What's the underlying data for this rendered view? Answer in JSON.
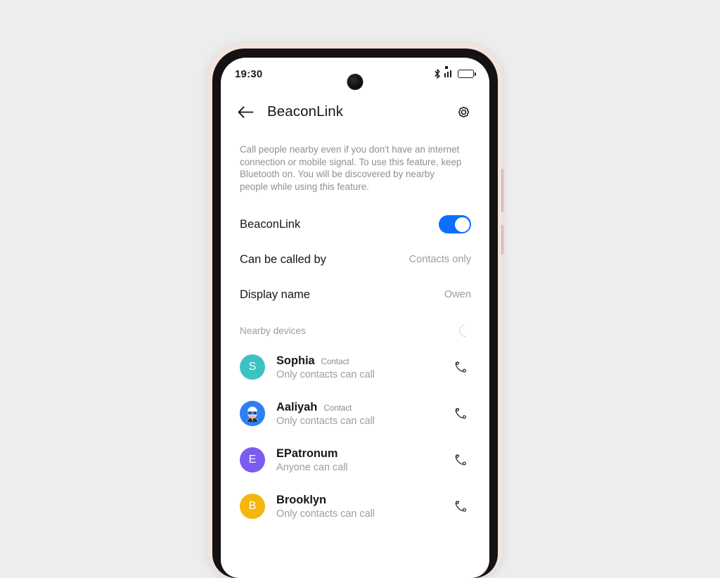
{
  "background_color": "#ededed",
  "device": {
    "frame_color": "#f4e3dd",
    "bezel_color": "#151213",
    "screen_color": "#ffffff",
    "buttons": [
      {
        "name": "volume-button"
      },
      {
        "name": "power-button"
      }
    ]
  },
  "status_bar": {
    "time": "19:30",
    "icons": [
      "bluetooth-icon",
      "signal-icon",
      "battery-icon"
    ]
  },
  "app_bar": {
    "back_icon": "back-arrow-icon",
    "title": "BeaconLink",
    "settings_icon": "gear-icon"
  },
  "description": "Call people nearby even if you don't have an internet connection or mobile signal. To use this feature, keep Bluetooth on. You will be discovered by nearby people while using this feature.",
  "settings": {
    "accent_color": "#0d6efd",
    "rows": [
      {
        "label": "BeaconLink",
        "control": "toggle",
        "value": "on"
      },
      {
        "label": "Can be called by",
        "control": "value",
        "value": "Contacts only"
      },
      {
        "label": "Display name",
        "control": "value",
        "value": "Owen"
      }
    ]
  },
  "nearby": {
    "title": "Nearby devices",
    "spinner": "loading-spinner-icon",
    "devices": [
      {
        "name": "Sophia",
        "badge": "Contact",
        "subtitle": "Only contacts can call",
        "avatar_type": "initial",
        "avatar_initial": "S",
        "avatar_color": "#3cc2c2",
        "call_icon": "phone-call-icon"
      },
      {
        "name": "Aaliyah",
        "badge": "Contact",
        "subtitle": "Only contacts can call",
        "avatar_type": "image",
        "avatar_initial": "",
        "avatar_color": "#2f7ff0",
        "call_icon": "phone-call-icon"
      },
      {
        "name": "EPatronum",
        "badge": "",
        "subtitle": "Anyone can call",
        "avatar_type": "initial",
        "avatar_initial": "E",
        "avatar_color": "#7a5cf0",
        "call_icon": "phone-call-icon"
      },
      {
        "name": "Brooklyn",
        "badge": "",
        "subtitle": "Only contacts can call",
        "avatar_type": "initial",
        "avatar_initial": "B",
        "avatar_color": "#f4b70d",
        "call_icon": "phone-call-icon"
      }
    ]
  }
}
